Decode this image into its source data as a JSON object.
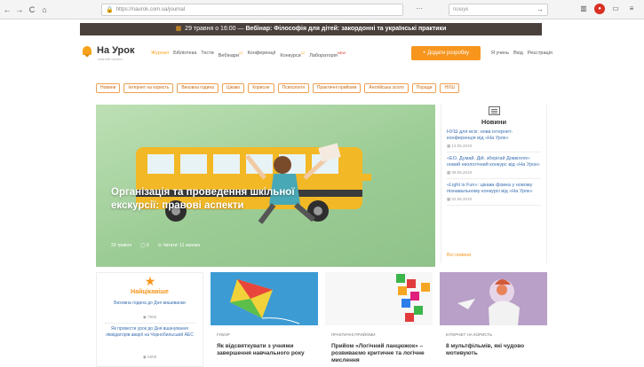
{
  "browser": {
    "url": "https://naurok.com.ua/journal",
    "search_placeholder": "пошук",
    "back": "←",
    "forward": "→",
    "reload": "C",
    "home": "⌂",
    "more": "···",
    "go": "→"
  },
  "banner": {
    "date_text": "29 травня о 16:00 —",
    "event_text": "Вебінар: Філософія для дітей: закордонні та українські практики"
  },
  "header": {
    "logo_text": "На Урок",
    "logo_sub": "освітній проект",
    "nav": [
      {
        "label": "Журнал",
        "active": true,
        "badge": ""
      },
      {
        "label": "Бібліотека",
        "active": false,
        "badge": ""
      },
      {
        "label": "Тести",
        "active": false,
        "badge": ""
      },
      {
        "label": "Вебінари",
        "active": false,
        "badge": "21"
      },
      {
        "label": "Конференції",
        "active": false,
        "badge": ""
      },
      {
        "label": "Конкурси",
        "active": false,
        "badge": "12"
      },
      {
        "label": "Лабораторія",
        "active": false,
        "badge": "NEW"
      }
    ],
    "add_button": "+ Додати розробку",
    "auth": [
      "Я учень",
      "Вхід",
      "Реєстрація"
    ]
  },
  "categories": [
    "Новини",
    "Інтернет на користь",
    "Виховна година",
    "Цікаво",
    "Корисне",
    "Психологія",
    "Практичні прийоми",
    "Англійська зсоло",
    "Поради",
    "НУШ"
  ],
  "hero": {
    "title": "Організація та проведення шкільної екскурсії: правові аспекти",
    "date": "29 травня",
    "comments": "0",
    "read_time": "Читати: 11 хвилин"
  },
  "news": {
    "title": "Новини",
    "items": [
      {
        "text": "НУШ для всіх: нова інтернет-конференція від «На Урок»",
        "date": "13.05.2019"
      },
      {
        "text": "«ЕО. Думай. Дій. зберігай Довкілля»: новий екологічний конкурс від «На Урок»",
        "date": "08.05.2019"
      },
      {
        "text": "«Light is Fun»: цікава фізика у новому пізнавальному конкурсі від «На Урок»",
        "date": "02.05.2019"
      }
    ],
    "all_link": "Всі новини"
  },
  "popular": {
    "title": "Найцікавіше",
    "items": [
      {
        "text": "Виховна година до Дня вишиванки",
        "views": "7906"
      },
      {
        "text": "Як провести урок до Дня вшанування ліквідаторів аварії на Чорнобильській АЕС",
        "views": "5609"
      }
    ]
  },
  "cards": [
    {
      "category": "ГУБОР",
      "title": "Як відсвяткувати з учнями завершення навчального року"
    },
    {
      "category": "ПРАКТИЧНІ ПРИЙОМИ",
      "title": "Прийом «Логічний ланцюжок» – розвиваємо критичне та логічне мислення"
    },
    {
      "category": "ІНТЕРНЕТ НА КОРИСТЬ",
      "title": "8 мультфільмів, які чудово мотивують"
    }
  ],
  "colors": {
    "accent": "#f7951d",
    "banner_bg": "#4a403c",
    "link": "#3a6fb0"
  }
}
